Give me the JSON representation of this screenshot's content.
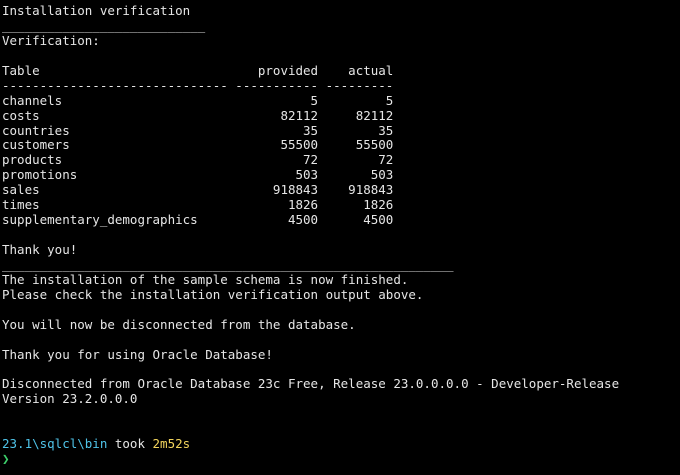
{
  "terminal": {
    "heading": "Installation verification",
    "underline1": "___________________________",
    "verification_label": "Verification:",
    "table": {
      "header": "Table                             provided    actual",
      "separator": "------------------------------ ----------- ---------",
      "rows": [
        "channels                                 5         5",
        "costs                                82112     82112",
        "countries                               35        35",
        "customers                            55500     55500",
        "products                                72        72",
        "promotions                             503       503",
        "sales                               918843    918843",
        "times                                 1826      1826",
        "supplementary_demographics            4500      4500"
      ]
    },
    "thank_you": "Thank you!",
    "underline2": "____________________________________________________________",
    "finished_line": "The installation of the sample schema is now finished.",
    "check_line": "Please check the installation verification output above.",
    "disconnect_notice": "You will now be disconnected from the database.",
    "thanks_oracle": "Thank you for using Oracle Database!",
    "disconnected_line": "Disconnected from Oracle Database 23c Free, Release 23.0.0.0.0 - Developer-Release",
    "version_line": "Version 23.2.0.0.0",
    "prompt": {
      "path": "23.1\\sqlcl\\bin",
      "took_word": " took ",
      "duration": "2m52s",
      "symbol": "❯"
    },
    "colors": {
      "background": "#000000",
      "text": "#e6e6e6",
      "path": "#4fc3e8",
      "duration": "#f2d45c",
      "prompt_symbol": "#3dd06b"
    }
  }
}
